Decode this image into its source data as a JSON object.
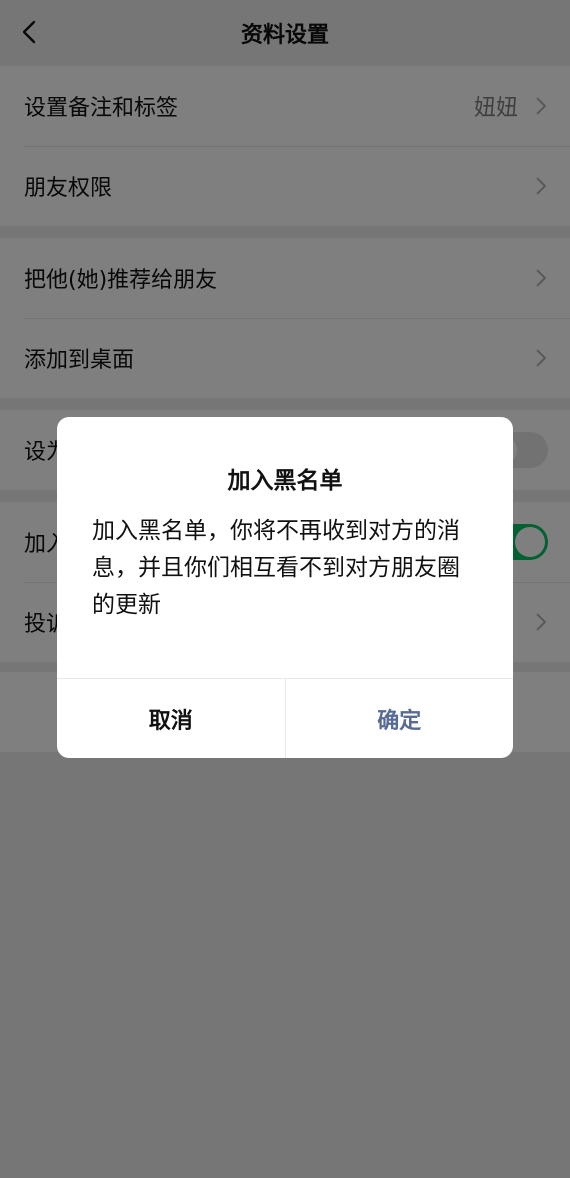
{
  "header": {
    "title": "资料设置",
    "back_icon": "chevron-left-icon"
  },
  "groups": [
    {
      "items": [
        {
          "label": "设置备注和标签",
          "value": "妞妞",
          "accessory": "chevron-right-icon"
        },
        {
          "label": "朋友权限",
          "accessory": "chevron-right-icon"
        }
      ]
    },
    {
      "items": [
        {
          "label": "把他(她)推荐给朋友",
          "accessory": "chevron-right-icon"
        },
        {
          "label": "添加到桌面",
          "accessory": "chevron-right-icon"
        }
      ]
    },
    {
      "items": [
        {
          "label": "设为",
          "accessory": "toggle",
          "toggle_on": false
        }
      ]
    },
    {
      "items": [
        {
          "label": "加入",
          "accessory": "toggle",
          "toggle_on": true
        },
        {
          "label": "投诉",
          "accessory": "chevron-right-icon"
        }
      ]
    }
  ],
  "dialog": {
    "title": "加入黑名单",
    "message": "加入黑名单，你将不再收到对方的消息，并且你们相互看不到对方朋友圈的更新",
    "cancel_label": "取消",
    "confirm_label": "确定"
  },
  "colors": {
    "background": "#ededed",
    "toggle_on": "#07c160",
    "confirm_text": "#576b95",
    "overlay": "rgba(0,0,0,0.5)"
  }
}
